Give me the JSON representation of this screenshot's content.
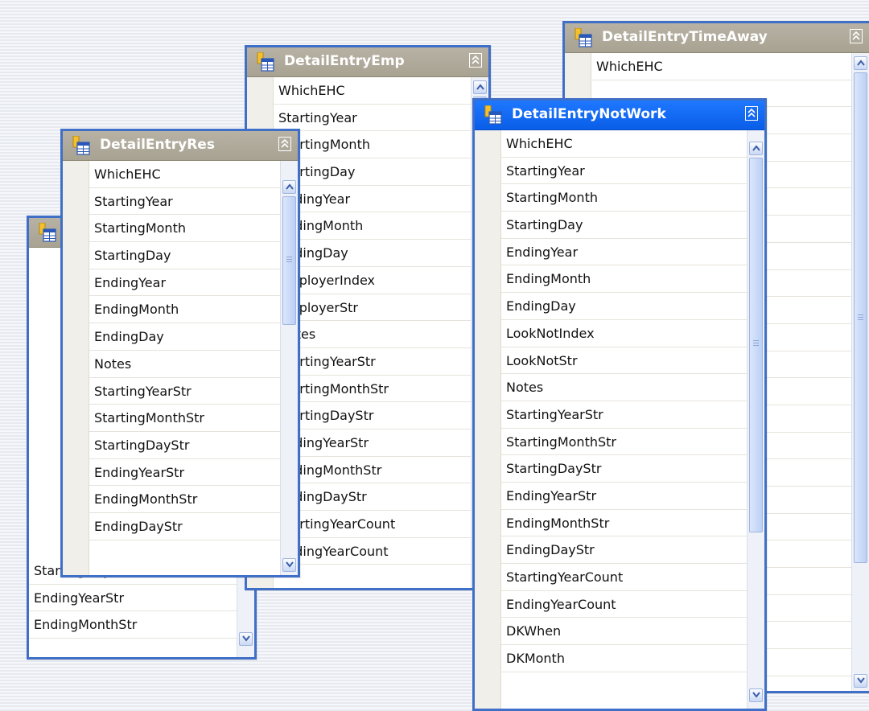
{
  "tables": {
    "time_away": {
      "title": "DetailEntryTimeAway",
      "columns": [
        "WhichEHC"
      ]
    },
    "emp": {
      "title": "DetailEntryEmp",
      "columns": [
        "WhichEHC",
        "StartingYear",
        "StartingMonth",
        "StartingDay",
        "EndingYear",
        "EndingMonth",
        "EndingDay",
        "EmployerIndex",
        "EmployerStr",
        "Notes",
        "StartingYearStr",
        "StartingMonthStr",
        "StartingDayStr",
        "EndingYearStr",
        "EndingMonthStr",
        "EndingDayStr",
        "StartingYearCount",
        "EndingYearCount"
      ]
    },
    "res": {
      "title": "DetailEntryRes",
      "columns": [
        "WhichEHC",
        "StartingYear",
        "StartingMonth",
        "StartingDay",
        "EndingYear",
        "EndingMonth",
        "EndingDay",
        "Notes",
        "StartingYearStr",
        "StartingMonthStr",
        "StartingDayStr",
        "EndingYearStr",
        "EndingMonthStr",
        "EndingDayStr"
      ]
    },
    "back": {
      "title": "",
      "columns": [
        "StartingDayStr",
        "EndingYearStr",
        "EndingMonthStr"
      ]
    },
    "not_work": {
      "title": "DetailEntryNotWork",
      "columns": [
        "WhichEHC",
        "StartingYear",
        "StartingMonth",
        "StartingDay",
        "EndingYear",
        "EndingMonth",
        "EndingDay",
        "LookNotIndex",
        "LookNotStr",
        "Notes",
        "StartingYearStr",
        "StartingMonthStr",
        "StartingDayStr",
        "EndingYearStr",
        "EndingMonthStr",
        "EndingDayStr",
        "StartingYearCount",
        "EndingYearCount",
        "DKWhen",
        "DKMonth"
      ]
    }
  },
  "colors": {
    "border_blue": "#3f6fc6",
    "title_inactive": "#aca694",
    "title_active": "#0a5ee8"
  },
  "icons": [
    "table-icon",
    "collapse-icon",
    "scroll-up-icon",
    "scroll-down-icon"
  ]
}
